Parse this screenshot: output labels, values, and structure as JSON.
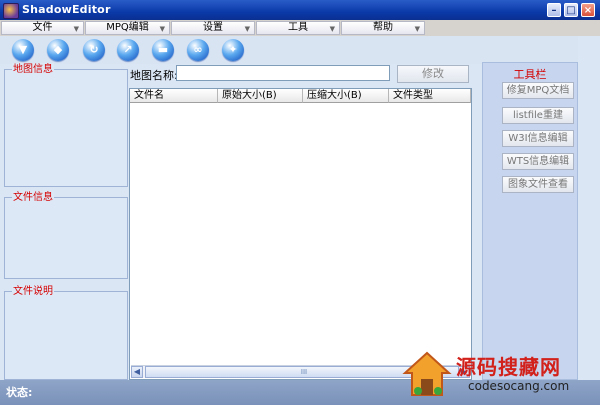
{
  "window": {
    "title": "ShadowEditor"
  },
  "menu": [
    "文件",
    "MPQ编辑",
    "设置",
    "工具",
    "帮助"
  ],
  "toolbar_icons": [
    "save-icon",
    "open-icon",
    "refresh-icon",
    "export-icon",
    "folder-icon",
    "link-icon",
    "globe-icon"
  ],
  "left_panel": {
    "map_info": "地图信息",
    "file_info": "文件信息",
    "file_desc": "文件说明"
  },
  "center": {
    "map_name_label": "地图名称:",
    "map_name_value": "",
    "modify_button": "修改",
    "columns": [
      "文件名",
      "原始大小(B)",
      "压缩大小(B)",
      "文件类型"
    ],
    "scroll_grip": "III"
  },
  "tools": {
    "title": "工具栏",
    "buttons": [
      "修复MPQ文档",
      "listfile重建",
      "W3I信息编辑",
      "WTS信息编辑",
      "图象文件查看"
    ]
  },
  "status": {
    "label": "状态:"
  },
  "watermark": {
    "title": "源码搜藏网",
    "url": "codesocang.com"
  },
  "colors": {
    "accent_red": "#d40000",
    "title_blue": "#0a3aa8"
  }
}
